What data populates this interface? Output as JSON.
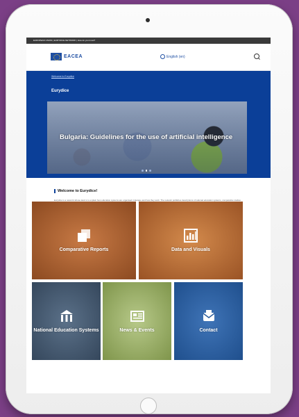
{
  "top_strip": {
    "text": "EUROPEAN UNION | EURYDICE NETWORK | How do you know?"
  },
  "header": {
    "logo_text": "EACEA",
    "language": "English (en)",
    "icons": [
      "eu-flag-icon",
      "globe-icon",
      "search-icon"
    ]
  },
  "blue_band": {
    "breadcrumb": "Welcome to Eurydice",
    "site_title": "Eurydice"
  },
  "banner": {
    "headline": "Bulgaria: Guidelines for the use of artificial intelligence",
    "slide_count": 3,
    "active_slide": 2
  },
  "welcome": {
    "title": "Welcome to Eurydice!",
    "body": "Eurydice is a network whose task is to explain how education systems are organised in Europe and how they work. The network publishes descriptions of national education systems, comparative studies devoted to specific topics, indicators and statistics in the field of education."
  },
  "tiles": {
    "reports": {
      "label": "Comparative Reports",
      "icon": "reports-icon"
    },
    "data": {
      "label": "Data and Visuals",
      "icon": "bar-chart-icon"
    },
    "systems": {
      "label": "National Education Systems",
      "icon": "building-icon"
    },
    "news": {
      "label": "News & Events",
      "icon": "newspaper-icon"
    },
    "contact": {
      "label": "Contact",
      "icon": "mail-icon"
    }
  },
  "colors": {
    "background": "#7b3f86",
    "brand_blue": "#0b3f98",
    "tile_reports": "#a8602f",
    "tile_data": "#b86c36",
    "tile_systems": "#45586d",
    "tile_news": "#9aaf66",
    "tile_contact": "#2d5f9f"
  }
}
